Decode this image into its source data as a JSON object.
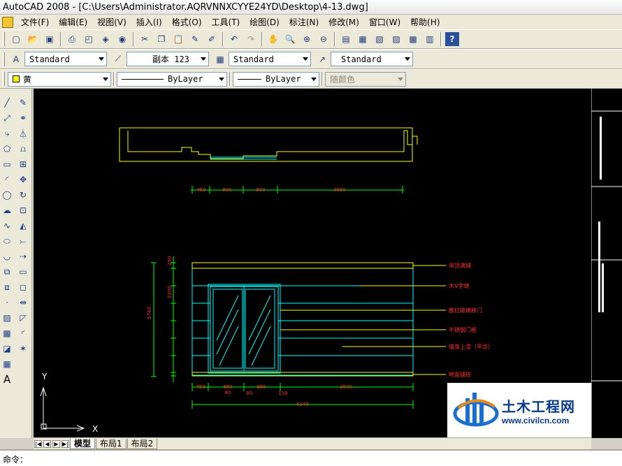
{
  "window": {
    "title": "AutoCAD 2008 - [C:\\Users\\Administrator.AQRVNNXCYYE24YD\\Desktop\\4-13.dwg]"
  },
  "menu": [
    "文件(F)",
    "编辑(E)",
    "视图(V)",
    "插入(I)",
    "格式(O)",
    "工具(T)",
    "绘图(D)",
    "标注(N)",
    "修改(M)",
    "窗口(W)",
    "帮助(H)"
  ],
  "styles": {
    "text_style": "Standard",
    "dim_style": "副本 123",
    "table_style": "Standard",
    "mleader_style": "Standard"
  },
  "properties": {
    "layer": "黄",
    "linetype": "ByLayer",
    "lineweight": "ByLayer",
    "plotstyle": "随颜色"
  },
  "drawing": {
    "plan_dims": [
      "450",
      "800",
      "800",
      "3850"
    ],
    "elev_top_dims": [
      "250",
      "2200",
      "5740"
    ],
    "bottom_dims": [
      "450",
      "680",
      "680",
      "3800"
    ],
    "bottom_small_dims": [
      "80",
      "80",
      "150"
    ],
    "overall_dim": "5340",
    "annotations": [
      "吊顶满铺",
      "木V字缝",
      "推拉玻璃移门",
      "不锈钢门框",
      "墙身上漆（平涂）",
      "地面铺砖"
    ],
    "ucs_x": "X",
    "ucs_y": "Y"
  },
  "tabs": [
    "模型",
    "布局1",
    "布局2"
  ],
  "command_prompt": "命令：",
  "watermark": {
    "title": "土木工程网",
    "url": "www.civilcn.com"
  }
}
